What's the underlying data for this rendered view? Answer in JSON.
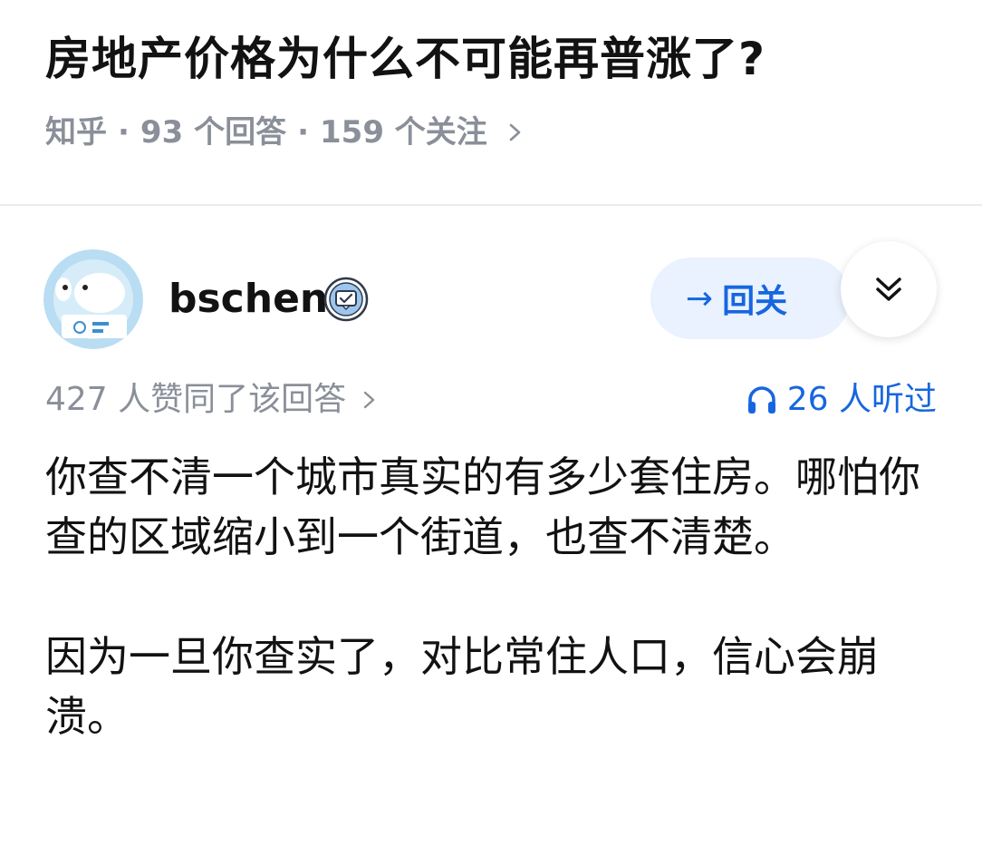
{
  "question": {
    "title": "房地产价格为什么不可能再普涨了?",
    "source": "知乎",
    "answers_count": "93 个回答",
    "followers_count": "159 个关注"
  },
  "author": {
    "name": "bschen",
    "avatar": "avatar-icon",
    "badge": "verified-icon"
  },
  "actions": {
    "follow_label": "回关",
    "follow_arrow": "→",
    "expand_icon": "double-chevron-down-icon"
  },
  "stats": {
    "likes_text": "427 人赞同了该回答",
    "listened_text": "26 人听过"
  },
  "answer": {
    "paragraphs": [
      "你查不清一个城市真实的有多少套住房。哪怕你查的区域缩小到一个街道，也查不清楚。",
      "因为一旦你查实了，对比常住人口，信心会崩溃。"
    ]
  },
  "colors": {
    "accent": "#1766e0",
    "follow_bg": "#e9f2fe",
    "meta_gray": "#8a8f99"
  }
}
